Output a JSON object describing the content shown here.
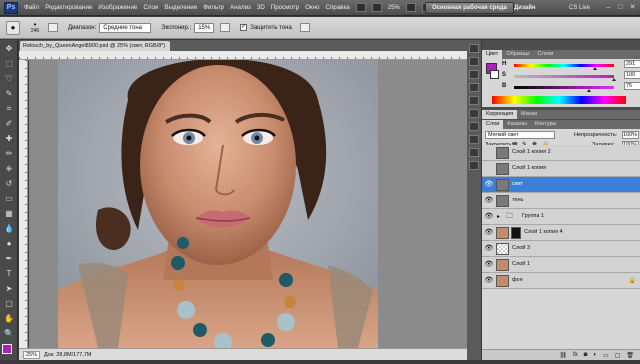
{
  "menubar": {
    "logo": "Ps",
    "items": [
      "Файл",
      "Редактирование",
      "Изображение",
      "Слои",
      "Выделение",
      "Фильтр",
      "Анализ",
      "3D",
      "Просмотр",
      "Окно",
      "Справка"
    ],
    "zoom": "25%",
    "workspace_active": "Основная рабочая среда",
    "workspace_design": "Дизайн",
    "cs_live": "CS Live"
  },
  "options": {
    "brush_size": "246",
    "range_label": "Диапазон:",
    "range_value": "Средние тона",
    "exposure_label": "Экспонир.:",
    "exposure_value": "15%",
    "protect_label": "Защитить тона"
  },
  "document": {
    "tab_title": "Relouch_by_QueenAngel8900.psd @ 25% (свет, RGB/8*)",
    "status_zoom": "25%",
    "status_doc": "Док: 28,8M/177,7M"
  },
  "color_panel": {
    "tabs": [
      "Цвет",
      "Образцы",
      "Стили"
    ],
    "h_label": "H",
    "s_label": "S",
    "b_label": "B",
    "h_value": "291",
    "s_value": "100",
    "b_value": "75",
    "swatch_color": "#b11fc0",
    "h_level": 0.81,
    "s_level": 1.0,
    "b_level": 0.75
  },
  "adjust_panel": {
    "tabs": [
      "Коррекция",
      "Маски"
    ]
  },
  "layers_panel": {
    "tabs": [
      "Слои",
      "Каналы",
      "Контуры"
    ],
    "blend_mode": "Мягкий свет",
    "opacity_label": "Непрозрачность:",
    "opacity_value": "100%",
    "lock_label": "Закрепить:",
    "fill_label": "Заливка:",
    "fill_value": "100%",
    "layers": [
      {
        "name": "Слой 1 копия 2",
        "visible": false,
        "selected": false
      },
      {
        "name": "Слой 1 копия",
        "visible": false,
        "selected": false
      },
      {
        "name": "свет",
        "visible": true,
        "selected": true
      },
      {
        "name": "тень",
        "visible": true,
        "selected": false
      },
      {
        "name": "Группа 1",
        "visible": true,
        "selected": false
      },
      {
        "name": "Слой 1 копия 4",
        "visible": true,
        "selected": false
      },
      {
        "name": "Слой 3",
        "visible": true,
        "selected": false
      },
      {
        "name": "Слой 1",
        "visible": true,
        "selected": false
      },
      {
        "name": "фон",
        "visible": true,
        "selected": false
      }
    ],
    "footer_icons": [
      "link-icon",
      "fx-icon",
      "mask-icon",
      "adjustment-icon",
      "folder-icon",
      "new-layer-icon",
      "trash-icon"
    ]
  }
}
